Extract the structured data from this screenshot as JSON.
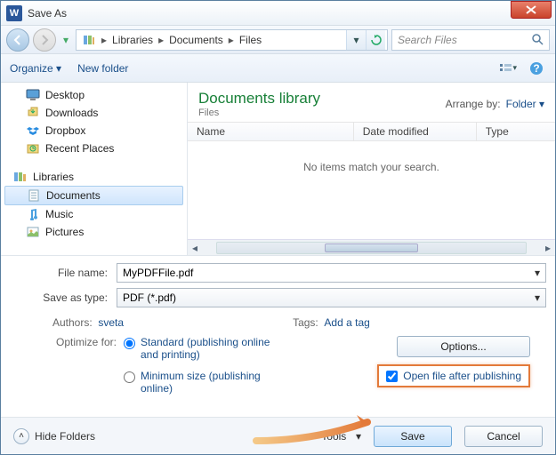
{
  "window": {
    "title": "Save As"
  },
  "nav": {
    "breadcrumb": [
      "Libraries",
      "Documents",
      "Files"
    ],
    "search_placeholder": "Search Files"
  },
  "toolbar": {
    "organize": "Organize",
    "new_folder": "New folder"
  },
  "tree": {
    "favorites": [
      {
        "icon": "desktop",
        "label": "Desktop"
      },
      {
        "icon": "downloads",
        "label": "Downloads"
      },
      {
        "icon": "dropbox",
        "label": "Dropbox"
      },
      {
        "icon": "recent",
        "label": "Recent Places"
      }
    ],
    "libraries_label": "Libraries",
    "libraries": [
      {
        "icon": "doc",
        "label": "Documents",
        "selected": true
      },
      {
        "icon": "music",
        "label": "Music"
      },
      {
        "icon": "pictures",
        "label": "Pictures"
      }
    ]
  },
  "main": {
    "heading": "Documents library",
    "subheading": "Files",
    "arrange_label": "Arrange by:",
    "arrange_value": "Folder",
    "columns": {
      "name": "Name",
      "date": "Date modified",
      "type": "Type"
    },
    "empty_text": "No items match your search."
  },
  "form": {
    "filename_label": "File name:",
    "filename_value": "MyPDFFile.pdf",
    "savetype_label": "Save as type:",
    "savetype_value": "PDF (*.pdf)",
    "authors_label": "Authors:",
    "authors_value": "sveta",
    "tags_label": "Tags:",
    "tags_value": "Add a tag",
    "optimize_label": "Optimize for:",
    "opt_standard": "Standard (publishing online and printing)",
    "opt_minimum": "Minimum size (publishing online)",
    "options_btn": "Options...",
    "open_after": "Open file after publishing"
  },
  "bottom": {
    "hide_folders": "Hide Folders",
    "tools": "Tools",
    "save": "Save",
    "cancel": "Cancel"
  }
}
